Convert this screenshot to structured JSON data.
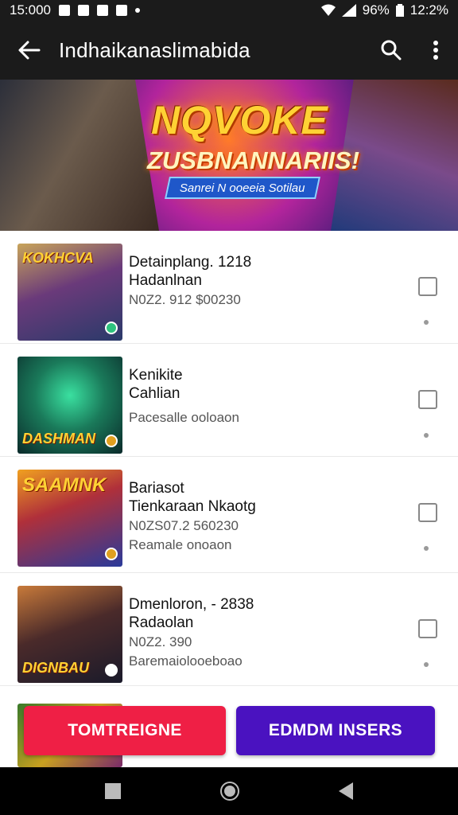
{
  "status_bar": {
    "time": "15:000",
    "battery": "96%",
    "clock": "12:2%"
  },
  "app_bar": {
    "title": "Indhaikanaslimabida"
  },
  "banner": {
    "logo_main": "NQVOKE",
    "logo_sub": "ZUSBNANNARIIS!",
    "ribbon": "Sanrei N ooeeia Sotilau"
  },
  "games": [
    {
      "thumb_label": "KOKHCVA",
      "line1": "Detainplang. 1218",
      "line2": "Hadanlnan",
      "line3": "N0Z2. 912 $00230",
      "line4": ""
    },
    {
      "thumb_label": "DASHMAN",
      "line1": "Kenikite",
      "line2": "Cahlian",
      "line3": "Pacesalle ooloaon",
      "line4": ""
    },
    {
      "thumb_label": "SAAMNK",
      "line1": "Bariasot",
      "line2": "Tienkaraan Nkaotg",
      "line3": "N0ZS07.2 560230",
      "line4": "Reamale onoaon"
    },
    {
      "thumb_label": "DIGNBAU",
      "line1": "Dmenloron, - 2838",
      "line2": "Radaolan",
      "line3": "N0Z2. 390",
      "line4": "Baremaiolooeboao"
    }
  ],
  "buttons": {
    "primary": "TOMTREIGNE",
    "secondary": "EDMDM INSERS"
  },
  "colors": {
    "primary_button": "#ef1f45",
    "secondary_button": "#4a12c0",
    "app_bar": "#1b1b1b"
  }
}
